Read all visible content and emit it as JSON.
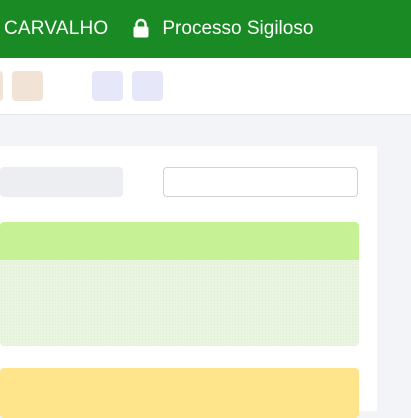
{
  "header": {
    "name": "CARVALHO",
    "secrecy_icon": "lock-icon",
    "secrecy_label": "Processo Sigiloso",
    "background_color": "#1a8a24"
  },
  "toolbar": {
    "buttons": [
      {
        "color": "#f2e3d7"
      },
      {
        "color": "#f2e3d7"
      },
      {
        "color": "#e6e7f8"
      },
      {
        "color": "#e6e7f8"
      }
    ]
  },
  "main": {
    "cards": [
      {
        "header_color": "#c6f195",
        "body_color": "#eaf5e1"
      },
      {
        "header_color": "#fee58c"
      }
    ]
  }
}
